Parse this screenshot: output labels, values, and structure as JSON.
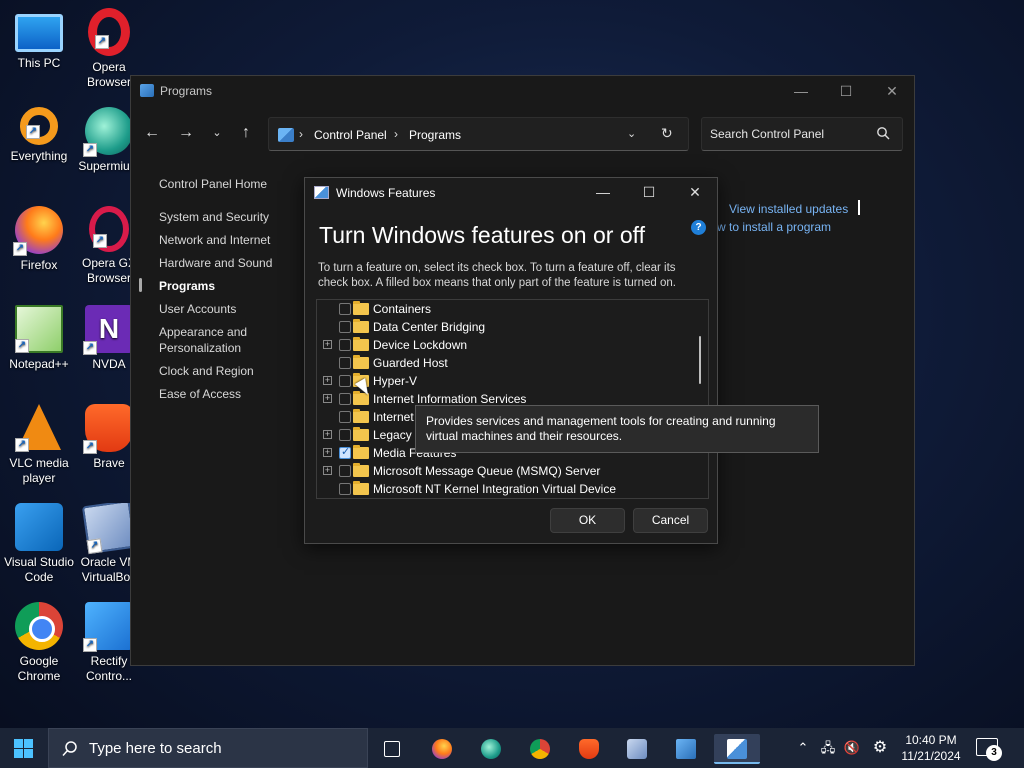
{
  "desktop": {
    "icons": [
      {
        "label": "This PC"
      },
      {
        "label": "Opera Browser"
      },
      {
        "label": "Everything"
      },
      {
        "label": "Supermium"
      },
      {
        "label": "Firefox"
      },
      {
        "label": "Opera GX Browser"
      },
      {
        "label": "Notepad++"
      },
      {
        "label": "NVDA"
      },
      {
        "label": "VLC media player"
      },
      {
        "label": "Brave"
      },
      {
        "label": "Visual Studio Code"
      },
      {
        "label": "Oracle VM VirtualBox"
      },
      {
        "label": "Google Chrome"
      },
      {
        "label": "Rectify Contro..."
      }
    ]
  },
  "programs_window": {
    "title": "Programs",
    "breadcrumb": [
      "Control Panel",
      "Programs"
    ],
    "search_placeholder": "Search Control Panel",
    "left_nav": {
      "home": "Control Panel Home",
      "items": [
        "System and Security",
        "Network and Internet",
        "Hardware and Sound",
        "Programs",
        "User Accounts",
        "Appearance and Personalization",
        "Clock and Region",
        "Ease of Access"
      ],
      "active_index": 3
    },
    "links": {
      "view_updates": "View installed updates",
      "install_program": "w to install a program"
    }
  },
  "features_dialog": {
    "title": "Windows Features",
    "heading": "Turn Windows features on or off",
    "description": "To turn a feature on, select its check box. To turn a feature off, clear its check box. A filled box means that only part of the feature is turned on.",
    "features": [
      {
        "label": "Containers",
        "expandable": false,
        "checked": false
      },
      {
        "label": "Data Center Bridging",
        "expandable": false,
        "checked": false
      },
      {
        "label": "Device Lockdown",
        "expandable": true,
        "checked": false
      },
      {
        "label": "Guarded Host",
        "expandable": false,
        "checked": false
      },
      {
        "label": "Hyper-V",
        "expandable": true,
        "checked": false
      },
      {
        "label": "Internet Information Services",
        "expandable": true,
        "checked": false
      },
      {
        "label": "Internet",
        "expandable": false,
        "checked": false
      },
      {
        "label": "Legacy C",
        "expandable": true,
        "checked": false
      },
      {
        "label": "Media Features",
        "expandable": true,
        "checked": true
      },
      {
        "label": "Microsoft Message Queue (MSMQ) Server",
        "expandable": true,
        "checked": false
      },
      {
        "label": "Microsoft NT Kernel Integration Virtual Device",
        "expandable": false,
        "checked": false
      }
    ],
    "tooltip": "Provides services and management tools for creating and running virtual machines and their resources.",
    "ok_label": "OK",
    "cancel_label": "Cancel"
  },
  "taskbar": {
    "search_placeholder": "Type here to search",
    "time": "10:40 PM",
    "date": "11/21/2024",
    "notification_count": "3"
  }
}
